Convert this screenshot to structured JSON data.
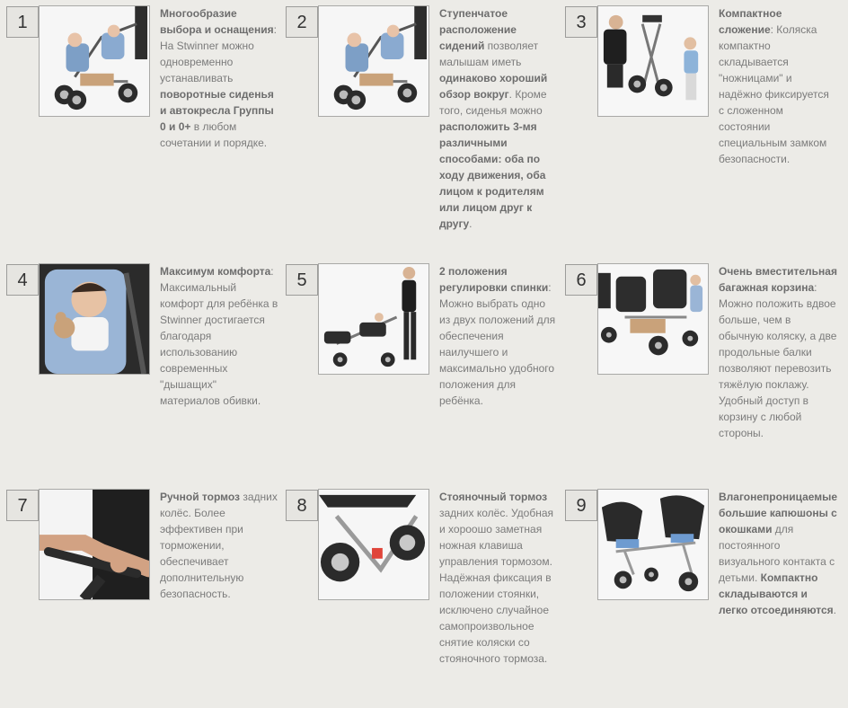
{
  "features": [
    {
      "number": "1",
      "description_parts": [
        {
          "text": "Многообразие выбора и оснащения",
          "bold": true
        },
        {
          "text": ": На Stwinner можно одновременно устанавливать ",
          "bold": false
        },
        {
          "text": "поворотные сиденья и автокресла Группы 0 и 0+",
          "bold": true
        },
        {
          "text": " в любом сочетании и порядке.",
          "bold": false
        }
      ]
    },
    {
      "number": "2",
      "description_parts": [
        {
          "text": "Ступенчатое расположение сидений",
          "bold": true
        },
        {
          "text": " позволяет малышам иметь ",
          "bold": false
        },
        {
          "text": "одинаково хороший обзор вокруг",
          "bold": true
        },
        {
          "text": ". Кроме того, сиденья можно ",
          "bold": false
        },
        {
          "text": "расположить 3-мя различными способами: оба по ходу движения, оба лицом к родителям или лицом друг к другу",
          "bold": true
        },
        {
          "text": ".",
          "bold": false
        }
      ]
    },
    {
      "number": "3",
      "description_parts": [
        {
          "text": "Компактное сложение",
          "bold": true
        },
        {
          "text": ": Коляска компактно складывается \"ножницами\" и надёжно фиксируется с сложенном состоянии специальным замком безопасности.",
          "bold": false
        }
      ]
    },
    {
      "number": "4",
      "description_parts": [
        {
          "text": "Максимум комфорта",
          "bold": true
        },
        {
          "text": ": Максимальный комфорт для ребёнка в Stwinner достигается благодаря использованию современных \"дышащих\" материалов обивки.",
          "bold": false
        }
      ]
    },
    {
      "number": "5",
      "description_parts": [
        {
          "text": "2 положения регулировки спинки",
          "bold": true
        },
        {
          "text": ": Можно выбрать одно из двух положений для обеспечения наилучшего и максимально удобного положения для ребёнка.",
          "bold": false
        }
      ]
    },
    {
      "number": "6",
      "description_parts": [
        {
          "text": "Очень вместительная багажная корзина",
          "bold": true
        },
        {
          "text": ": Можно положить вдвое больше, чем в обычную коляску, а две продольные балки позволяют перевозить тяжёлую поклажу. Удобный доступ в корзину с любой стороны.",
          "bold": false
        }
      ]
    },
    {
      "number": "7",
      "description_parts": [
        {
          "text": "Ручной тормоз",
          "bold": true
        },
        {
          "text": " задних колёс. Более эффективен при торможении, обеспечивает дополнительную безопасность.",
          "bold": false
        }
      ]
    },
    {
      "number": "8",
      "description_parts": [
        {
          "text": "Стояночный тормоз",
          "bold": true
        },
        {
          "text": " задних колёс. Удобная и хороошо заметная ножная клавиша управления тормозом. Надёжная фиксация в положении стоянки, исключено случайное самопроизвольное снятие коляски со стояночного тормоза.",
          "bold": false
        }
      ]
    },
    {
      "number": "9",
      "description_parts": [
        {
          "text": "Влагонепроницаемые большие капюшоны с окошками",
          "bold": true
        },
        {
          "text": " для постоянного визуального контакта с детьми. ",
          "bold": false
        },
        {
          "text": "Компактно складываются и легко отсоединяются",
          "bold": true
        },
        {
          "text": ".",
          "bold": false
        }
      ]
    }
  ]
}
